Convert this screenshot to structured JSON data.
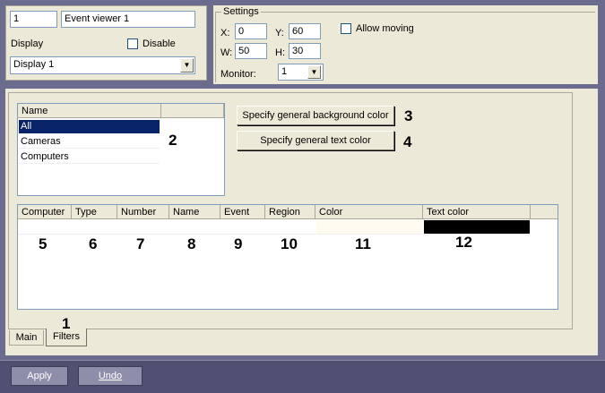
{
  "top": {
    "id_value": "1",
    "name_value": "Event viewer 1",
    "display_label": "Display",
    "disable_label": "Disable",
    "display_select": "Display 1"
  },
  "settings": {
    "title": "Settings",
    "x_label": "X:",
    "x_value": "0",
    "y_label": "Y:",
    "y_value": "60",
    "w_label": "W:",
    "w_value": "50",
    "h_label": "H:",
    "h_value": "30",
    "monitor_label": "Monitor:",
    "monitor_value": "1",
    "allow_moving_label": "Allow moving"
  },
  "filters": {
    "list_header": "Name",
    "items": [
      "All",
      "Cameras",
      "Computers"
    ],
    "bg_button": "Specify general background color",
    "text_button": "Specify general text color",
    "columns": [
      "Computer",
      "Type",
      "Number",
      "Name",
      "Event",
      "Region",
      "Color",
      "Text color"
    ],
    "row_colors": {
      "color": "#fffbf0",
      "text_color": "#000000"
    }
  },
  "callouts": [
    "1",
    "2",
    "3",
    "4",
    "5",
    "6",
    "7",
    "8",
    "9",
    "10",
    "11",
    "12"
  ],
  "tabs": [
    "Main",
    "Filters"
  ],
  "footer": {
    "apply": "Apply",
    "undo": "Undo"
  }
}
